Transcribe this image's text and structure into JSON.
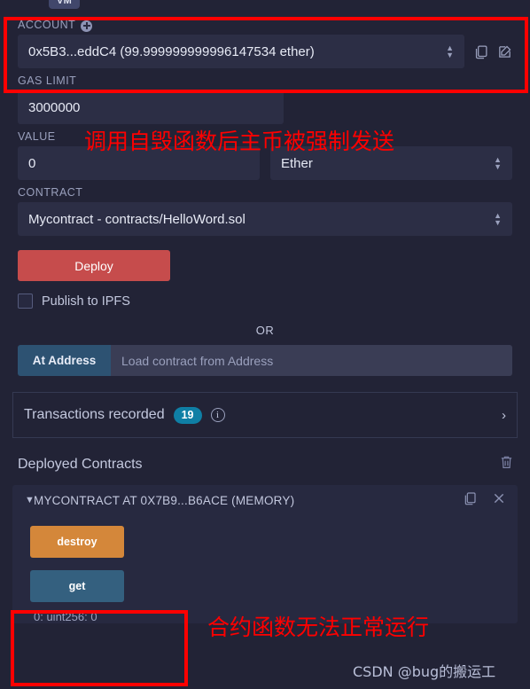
{
  "env": {
    "badge": "VM"
  },
  "account": {
    "label": "ACCOUNT",
    "add_icon": "plus-circle-icon",
    "value": "0x5B3...eddC4 (99.999999999996147534 ether)",
    "copy_icon": "copy-icon",
    "edit_icon": "edit-icon"
  },
  "gas_limit": {
    "label": "GAS LIMIT",
    "value": "3000000"
  },
  "value_field": {
    "label": "VALUE",
    "value": "0",
    "unit": "Ether"
  },
  "contract": {
    "label": "CONTRACT",
    "value": "Mycontract - contracts/HelloWord.sol"
  },
  "deploy": {
    "label": "Deploy"
  },
  "ipfs": {
    "label": "Publish to IPFS",
    "checked": false
  },
  "or": {
    "label": "OR"
  },
  "at_address": {
    "button_label": "At Address",
    "placeholder": "Load contract from Address"
  },
  "transactions": {
    "title": "Transactions recorded",
    "count": "19",
    "info_icon": "info-icon",
    "chevron_icon": "chevron-right-icon"
  },
  "deployed": {
    "title": "Deployed Contracts",
    "trash_icon": "trash-icon",
    "contract_card": {
      "chevron_icon": "chevron-down-icon",
      "name": "MYCONTRACT AT 0X7B9...B6ACE (MEMORY)",
      "copy_icon": "copy-icon",
      "close_icon": "close-icon",
      "functions": [
        {
          "label": "destroy",
          "kind": "transact"
        },
        {
          "label": "get",
          "kind": "call"
        }
      ],
      "result": "0: uint256: 0"
    }
  },
  "annotations": {
    "note_top": "调用自毁函数后主币被强制发送",
    "note_bottom": "合约函数无法正常运行",
    "watermark": "CSDN @bug的搬运工",
    "highlight_color": "#ff0000"
  }
}
